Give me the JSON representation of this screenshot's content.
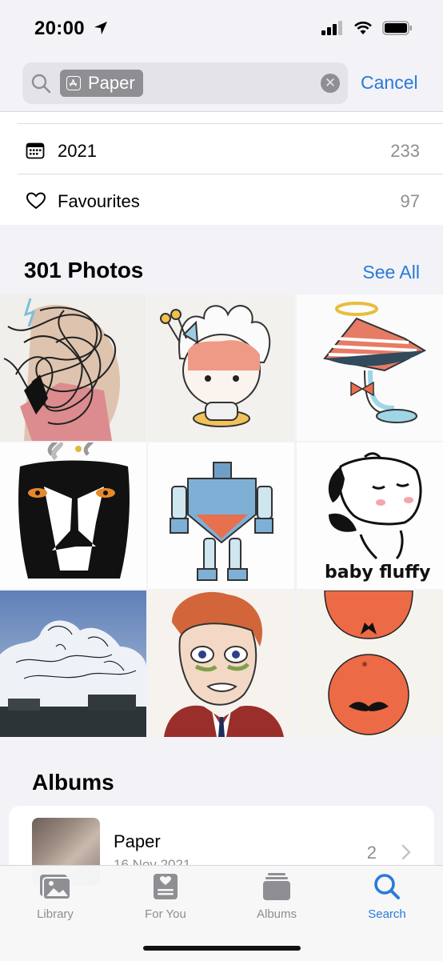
{
  "status": {
    "time": "20:00"
  },
  "search": {
    "token": "Paper",
    "cancel_label": "Cancel"
  },
  "list": [
    {
      "label": "2021",
      "count": "233",
      "icon": "calendar-icon"
    },
    {
      "label": "Favourites",
      "count": "97",
      "icon": "heart-icon"
    }
  ],
  "photos_section": {
    "title": "301 Photos",
    "see_all": "See All"
  },
  "photos": [
    {
      "subject": "scribble-sketch"
    },
    {
      "subject": "chibi-character"
    },
    {
      "subject": "lamp-with-halo"
    },
    {
      "subject": "stone-face"
    },
    {
      "subject": "robot"
    },
    {
      "subject": "puppy",
      "caption": "baby fluffy"
    },
    {
      "subject": "cloud-photo"
    },
    {
      "subject": "portrait"
    },
    {
      "subject": "oranges"
    }
  ],
  "albums_section": {
    "title": "Albums"
  },
  "album": {
    "name": "Paper",
    "date": "16 Nov 2021",
    "count": "2"
  },
  "tabs": [
    {
      "label": "Library",
      "icon": "photo-library-icon",
      "active": false
    },
    {
      "label": "For You",
      "icon": "for-you-icon",
      "active": false
    },
    {
      "label": "Albums",
      "icon": "albums-icon",
      "active": false
    },
    {
      "label": "Search",
      "icon": "search-icon",
      "active": true
    }
  ],
  "colors": {
    "accent": "#2a7ad9",
    "secondary_text": "#8e8e93"
  }
}
